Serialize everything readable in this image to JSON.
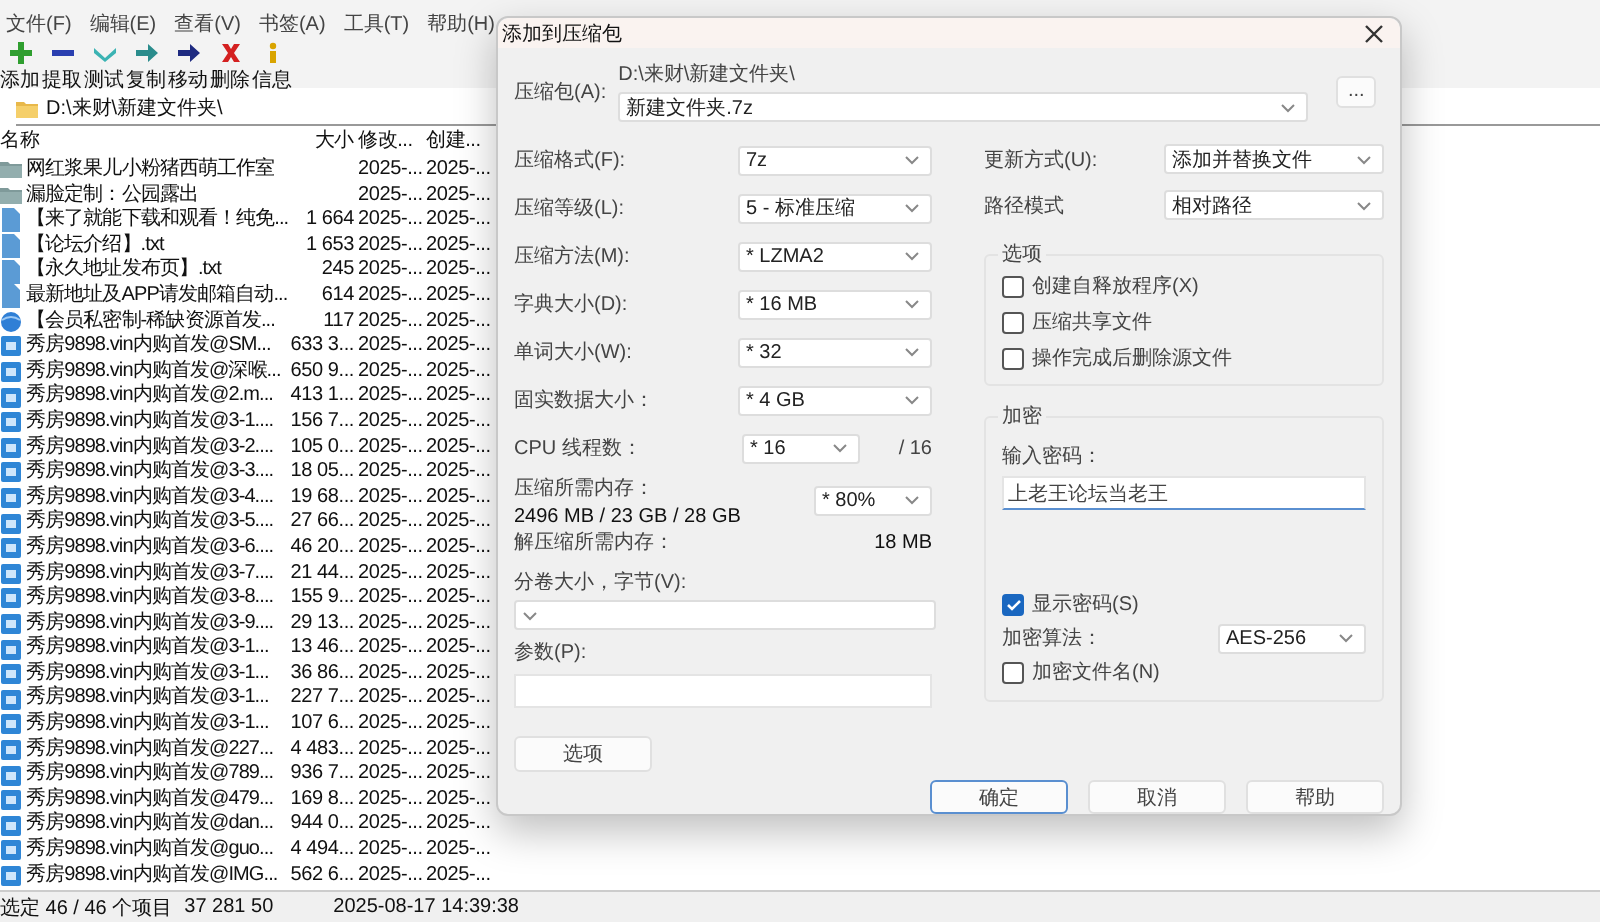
{
  "menu": [
    "文件(F)",
    "编辑(E)",
    "查看(V)",
    "书签(A)",
    "工具(T)",
    "帮助(H)"
  ],
  "toolbar": [
    {
      "label": "添加",
      "kind": "add"
    },
    {
      "label": "提取",
      "kind": "extract"
    },
    {
      "label": "测试",
      "kind": "test"
    },
    {
      "label": "复制",
      "kind": "copy"
    },
    {
      "label": "移动",
      "kind": "move"
    },
    {
      "label": "删除",
      "kind": "delete"
    },
    {
      "label": "信息",
      "kind": "info"
    }
  ],
  "address": "D:\\来财\\新建文件夹\\",
  "columns": [
    "名称",
    "大小",
    "修改...",
    "创建..."
  ],
  "rows": [
    {
      "kind": "folder",
      "name": "网红浆果儿小粉猪西萌工作室",
      "modified": "2025-...",
      "created": "2025-..."
    },
    {
      "kind": "folder",
      "name": "漏脸定制：公园露出",
      "modified": "2025-...",
      "created": "2025-..."
    },
    {
      "kind": "document",
      "name": "【来了就能下载和观看！纯免...",
      "size": "1 664",
      "modified": "2025-...",
      "created": "2025-..."
    },
    {
      "kind": "document",
      "name": "【论坛介绍】.txt",
      "size": "1 653",
      "modified": "2025-...",
      "created": "2025-..."
    },
    {
      "kind": "document",
      "name": "【永久地址发布页】.txt",
      "size": "245",
      "modified": "2025-...",
      "created": "2025-..."
    },
    {
      "kind": "document",
      "name": "最新地址及APP请发邮箱自动...",
      "size": "614",
      "modified": "2025-...",
      "created": "2025-..."
    },
    {
      "kind": "web",
      "name": "【会员私密制-稀缺资源首发...",
      "size": "117",
      "modified": "2025-...",
      "created": "2025-..."
    },
    {
      "kind": "video",
      "name": "秀房9898.vin内购首发@SM...",
      "size": "633 3...",
      "modified": "2025-...",
      "created": "2025-..."
    },
    {
      "kind": "video",
      "name": "秀房9898.vin内购首发@深喉...",
      "size": "650 9...",
      "modified": "2025-...",
      "created": "2025-..."
    },
    {
      "kind": "video",
      "name": "秀房9898.vin内购首发@2.m...",
      "size": "413 1...",
      "modified": "2025-...",
      "created": "2025-..."
    },
    {
      "kind": "video",
      "name": "秀房9898.vin内购首发@3-1....",
      "size": "156 7...",
      "modified": "2025-...",
      "created": "2025-..."
    },
    {
      "kind": "video",
      "name": "秀房9898.vin内购首发@3-2....",
      "size": "105 0...",
      "modified": "2025-...",
      "created": "2025-..."
    },
    {
      "kind": "video",
      "name": "秀房9898.vin内购首发@3-3....",
      "size": "18 05...",
      "modified": "2025-...",
      "created": "2025-..."
    },
    {
      "kind": "video",
      "name": "秀房9898.vin内购首发@3-4....",
      "size": "19 68...",
      "modified": "2025-...",
      "created": "2025-..."
    },
    {
      "kind": "video",
      "name": "秀房9898.vin内购首发@3-5....",
      "size": "27 66...",
      "modified": "2025-...",
      "created": "2025-..."
    },
    {
      "kind": "video",
      "name": "秀房9898.vin内购首发@3-6....",
      "size": "46 20...",
      "modified": "2025-...",
      "created": "2025-..."
    },
    {
      "kind": "video",
      "name": "秀房9898.vin内购首发@3-7....",
      "size": "21 44...",
      "modified": "2025-...",
      "created": "2025-..."
    },
    {
      "kind": "video",
      "name": "秀房9898.vin内购首发@3-8....",
      "size": "155 9...",
      "modified": "2025-...",
      "created": "2025-..."
    },
    {
      "kind": "video",
      "name": "秀房9898.vin内购首发@3-9....",
      "size": "29 13...",
      "modified": "2025-...",
      "created": "2025-..."
    },
    {
      "kind": "video",
      "name": "秀房9898.vin内购首发@3-1...",
      "size": "13 46...",
      "modified": "2025-...",
      "created": "2025-..."
    },
    {
      "kind": "video",
      "name": "秀房9898.vin内购首发@3-1...",
      "size": "36 86...",
      "modified": "2025-...",
      "created": "2025-..."
    },
    {
      "kind": "video",
      "name": "秀房9898.vin内购首发@3-1...",
      "size": "227 7...",
      "modified": "2025-...",
      "created": "2025-..."
    },
    {
      "kind": "video",
      "name": "秀房9898.vin内购首发@3-1...",
      "size": "107 6...",
      "modified": "2025-...",
      "created": "2025-..."
    },
    {
      "kind": "video",
      "name": "秀房9898.vin内购首发@227...",
      "size": "4 483...",
      "modified": "2025-...",
      "created": "2025-..."
    },
    {
      "kind": "video",
      "name": "秀房9898.vin内购首发@789...",
      "size": "936 7...",
      "modified": "2025-...",
      "created": "2025-..."
    },
    {
      "kind": "video",
      "name": "秀房9898.vin内购首发@479...",
      "size": "169 8...",
      "modified": "2025-...",
      "created": "2025-..."
    },
    {
      "kind": "video",
      "name": "秀房9898.vin内购首发@dan...",
      "size": "944 0...",
      "modified": "2025-...",
      "created": "2025-..."
    },
    {
      "kind": "video",
      "name": "秀房9898.vin内购首发@guo...",
      "size": "4 494...",
      "modified": "2025-...",
      "created": "2025-..."
    },
    {
      "kind": "video",
      "name": "秀房9898.vin内购首发@IMG...",
      "size": "562 6...",
      "modified": "2025-...",
      "created": "2025-..."
    }
  ],
  "status_bar": {
    "selection": "选定 46 / 46 个项目",
    "size": "37 281 50",
    "date": "2025-08-17 14:39:38"
  },
  "dialog": {
    "title": "添加到压缩包",
    "archive": {
      "label": "压缩包(A):",
      "folder": "D:\\来财\\新建文件夹\\",
      "name": "新建文件夹.7z"
    },
    "browse": "...",
    "settings": [
      {
        "label": "压缩格式(F):",
        "value": "7z"
      },
      {
        "label": "压缩等级(L):",
        "value": "5 - 标准压缩"
      },
      {
        "label": "压缩方法(M):",
        "value": "* LZMA2"
      },
      {
        "label": "字典大小(D):",
        "value": "* 16 MB"
      },
      {
        "label": "单词大小(W):",
        "value": "* 32"
      },
      {
        "label": "固实数据大小：",
        "value": "* 4 GB"
      },
      {
        "label": "CPU 线程数：",
        "value": "* 16",
        "suffix": "/ 16"
      }
    ],
    "memory": {
      "label": "压缩所需内存：",
      "value": "2496 MB / 23 GB / 28 GB",
      "limit": "* 80%"
    },
    "unpack": {
      "label": "解压缩所需内存：",
      "value": "18 MB"
    },
    "volume": {
      "label": "分卷大小，字节(V):"
    },
    "params": {
      "label": "参数(P):"
    },
    "options_button": "选项",
    "update": {
      "label": "更新方式(U):",
      "value": "添加并替换文件"
    },
    "path_mode": {
      "label": "路径模式",
      "value": "相对路径"
    },
    "options_group": {
      "title": "选项",
      "checks": [
        {
          "label": "创建自释放程序(X)",
          "checked": false
        },
        {
          "label": "压缩共享文件",
          "checked": false
        },
        {
          "label": "操作完成后删除源文件",
          "checked": false
        }
      ]
    },
    "encryption": {
      "title": "加密",
      "password_label": "输入密码：",
      "password": "上老王论坛当老王",
      "show_password": {
        "label": "显示密码(S)",
        "checked": true
      },
      "method": {
        "label": "加密算法：",
        "value": "AES-256"
      },
      "encrypt_names": {
        "label": "加密文件名(N)",
        "checked": false
      }
    },
    "buttons": [
      {
        "label": "确定",
        "default": true
      },
      {
        "label": "取消",
        "default": false
      },
      {
        "label": "帮助",
        "default": false
      }
    ]
  }
}
